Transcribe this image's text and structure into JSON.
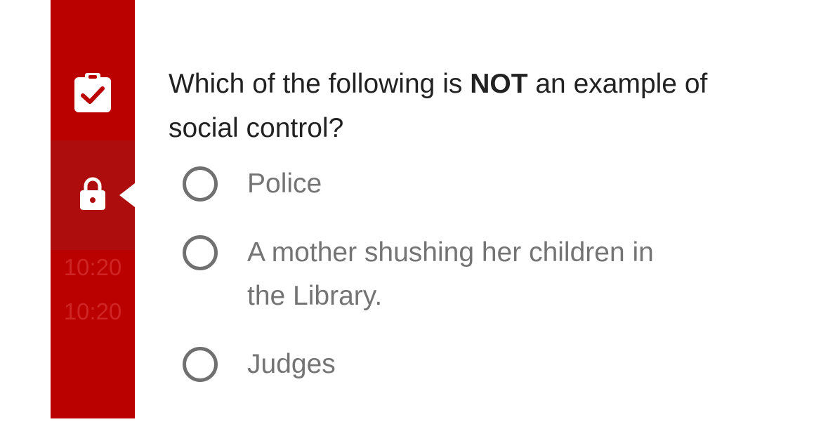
{
  "sidebar": {
    "items": [
      {
        "icon": "clipboard-check-icon"
      },
      {
        "icon": "lock-icon",
        "active": true
      }
    ],
    "times": [
      "10:20",
      "10:20"
    ],
    "colors": {
      "background": "#bb0000",
      "active": "#ad0d0d",
      "time_text": "#cf2525"
    }
  },
  "question": {
    "text_before": "Which of the following is ",
    "emphasis": "NOT",
    "text_after": " an example of social control?"
  },
  "options": [
    {
      "label": "Police"
    },
    {
      "label": "A mother shushing her children in the Library."
    },
    {
      "label": "Judges"
    }
  ]
}
